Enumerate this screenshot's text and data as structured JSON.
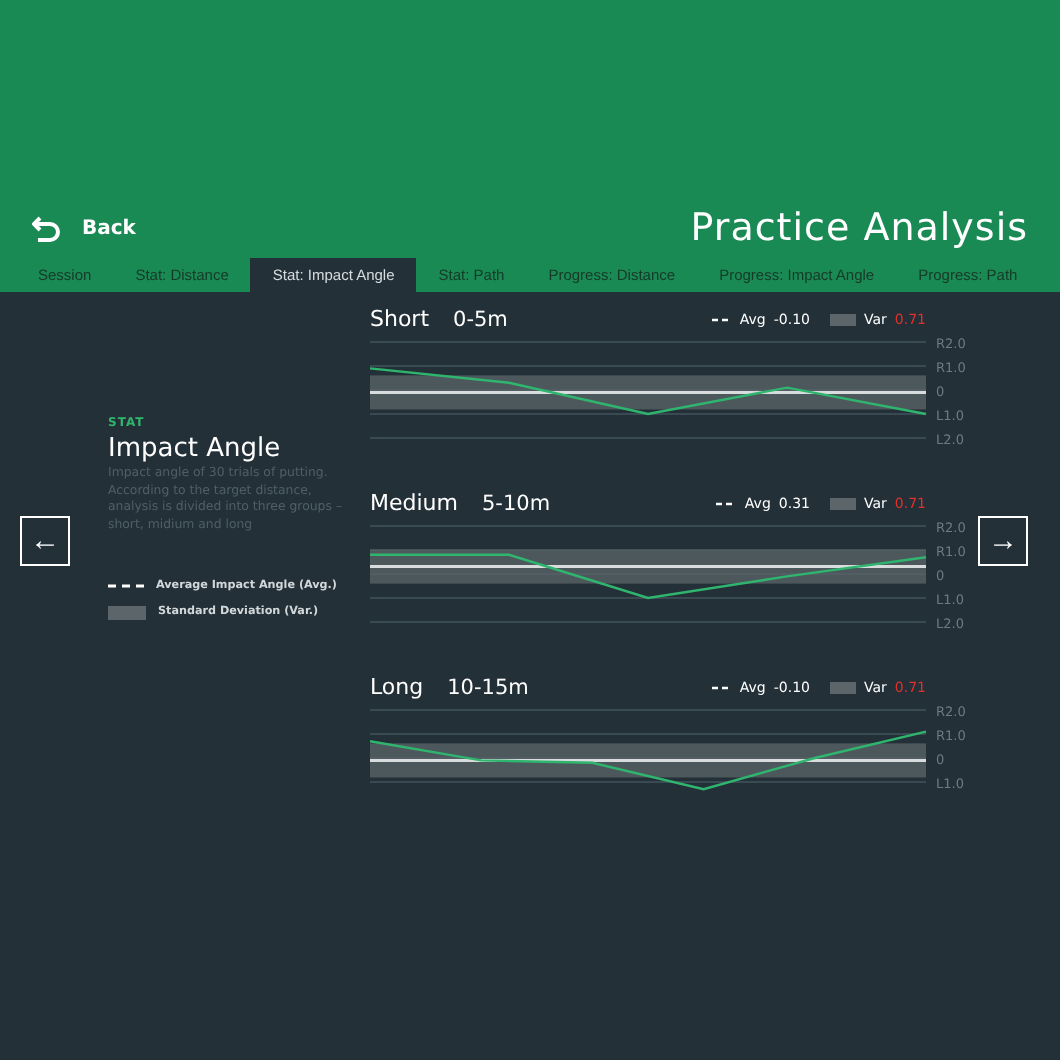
{
  "header": {
    "back_label": "Back",
    "title": "Practice Analysis"
  },
  "tabs": [
    {
      "label": "Session",
      "selected": false
    },
    {
      "label": "Stat: Distance",
      "selected": false
    },
    {
      "label": "Stat: Impact Angle",
      "selected": true
    },
    {
      "label": "Stat: Path",
      "selected": false
    },
    {
      "label": "Progress: Distance",
      "selected": false
    },
    {
      "label": "Progress: Impact Angle",
      "selected": false
    },
    {
      "label": "Progress: Path",
      "selected": false
    }
  ],
  "info": {
    "eyebrow": "STAT",
    "title": "Impact Angle",
    "description": "Impact angle of 30 trials of putting.\nAccording to the target distance, analysis is divided into three groups – short, midium and long",
    "legend": [
      {
        "kind": "dashed",
        "label": "Average Impact Angle (Avg.)"
      },
      {
        "kind": "band",
        "label": "Standard Deviation (Var.)"
      }
    ]
  },
  "groups": [
    {
      "name": "Short",
      "range": "0-5m",
      "avg_label": "Avg",
      "avg": "-0.10",
      "var_label": "Var",
      "var": "0.71",
      "axis_labels": [
        "R2.0",
        "R1.0",
        "0",
        "L1.0",
        "L2.0"
      ]
    },
    {
      "name": "Medium",
      "range": "5-10m",
      "avg_label": "Avg",
      "avg": "0.31",
      "var_label": "Var",
      "var": "0.71",
      "axis_labels": [
        "R2.0",
        "R1.0",
        "0",
        "L1.0",
        "L2.0"
      ]
    },
    {
      "name": "Long",
      "range": "10-15m",
      "avg_label": "Avg",
      "avg": "-0.10",
      "var_label": "Var",
      "var": "0.71",
      "axis_labels": [
        "R2.0",
        "R1.0",
        "0",
        "L1.0"
      ]
    }
  ],
  "nav": {
    "prev": "←",
    "next": "→"
  }
}
